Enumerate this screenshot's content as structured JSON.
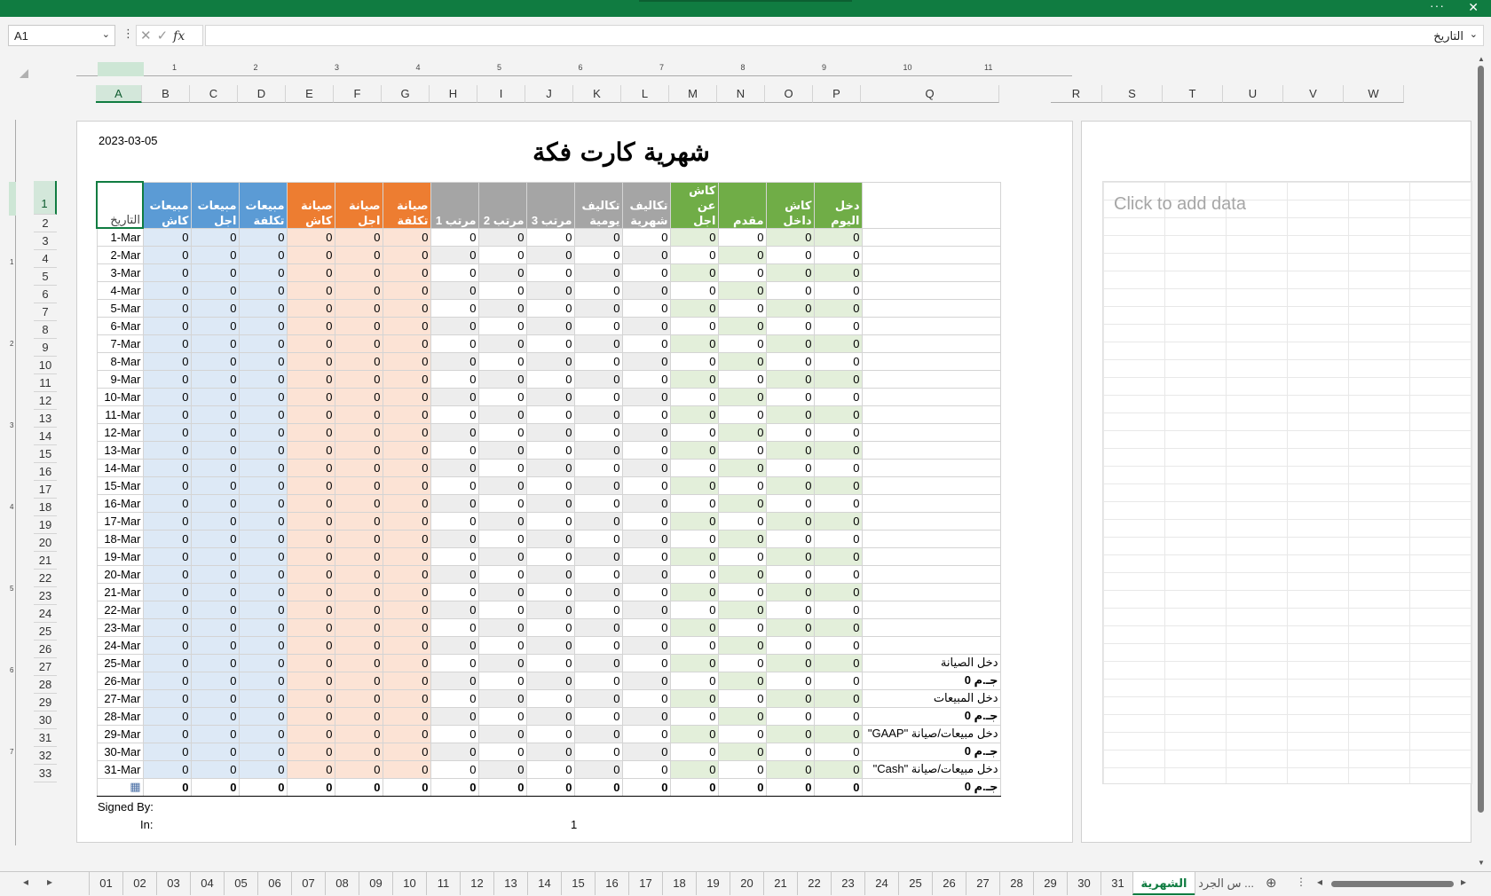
{
  "name_box": "A1",
  "formula": "التاريخ",
  "page_date": "2023-03-05",
  "page_title": "شهرية كارت فكة",
  "chart_placeholder": "Click to add data",
  "signed_by": "Signed By:",
  "in_label": "In:",
  "in_value": "1",
  "ruler_numbers": [
    "1",
    "2",
    "3",
    "4",
    "5",
    "6",
    "7",
    "8",
    "9",
    "10",
    "11"
  ],
  "ruler_left_numbers": [
    "1",
    "2",
    "3",
    "4",
    "5",
    "6",
    "7"
  ],
  "columns": [
    "A",
    "B",
    "C",
    "D",
    "E",
    "F",
    "G",
    "H",
    "I",
    "J",
    "K",
    "L",
    "M",
    "N",
    "O",
    "P",
    "Q",
    "R",
    "S",
    "T",
    "U",
    "V",
    "W"
  ],
  "headers": [
    "التاريخ",
    "مبيعات كاش",
    "مبيعات اجل",
    "مبيعات تكلفة",
    "صيانة كاش",
    "صيانة اجل",
    "صيانة تكلفة",
    "مرتب 1",
    "مرتب 2",
    "مرتب 3",
    "تكاليف يومية",
    "تكاليف شهرية",
    "كاش عن اجل",
    "مقدم",
    "كاش داخل",
    "دخل اليوم"
  ],
  "dates": [
    "1-Mar",
    "2-Mar",
    "3-Mar",
    "4-Mar",
    "5-Mar",
    "6-Mar",
    "7-Mar",
    "8-Mar",
    "9-Mar",
    "10-Mar",
    "11-Mar",
    "12-Mar",
    "13-Mar",
    "14-Mar",
    "15-Mar",
    "16-Mar",
    "17-Mar",
    "18-Mar",
    "19-Mar",
    "20-Mar",
    "21-Mar",
    "22-Mar",
    "23-Mar",
    "24-Mar",
    "25-Mar",
    "26-Mar",
    "27-Mar",
    "28-Mar",
    "29-Mar",
    "30-Mar",
    "31-Mar"
  ],
  "cell_value": "0",
  "total_value": "0",
  "summary": {
    "26": "دخل الصيانة",
    "27": "جـ.م 0",
    "28": "دخل المبيعات",
    "29": "جـ.م 0",
    "30": "دخل مبيعات/صيانة \"GAAP\"",
    "31": "جـ.م 0",
    "32": "دخل مبيعات/صيانة \"Cash\"",
    "33": "جـ.م 0"
  },
  "sheet_tabs": [
    "01",
    "02",
    "03",
    "04",
    "05",
    "06",
    "07",
    "08",
    "09",
    "10",
    "11",
    "12",
    "13",
    "14",
    "15",
    "16",
    "17",
    "18",
    "19",
    "20",
    "21",
    "22",
    "23",
    "24",
    "25",
    "26",
    "27",
    "28",
    "29",
    "30",
    "31"
  ],
  "active_tab": "الشهرية",
  "extra_tab": "س الجرد ...",
  "colors": {
    "accent": "#107c41",
    "blue": "#5b9bd5",
    "orange": "#ed7d31",
    "gray": "#a5a5a5",
    "green": "#70ad47"
  }
}
